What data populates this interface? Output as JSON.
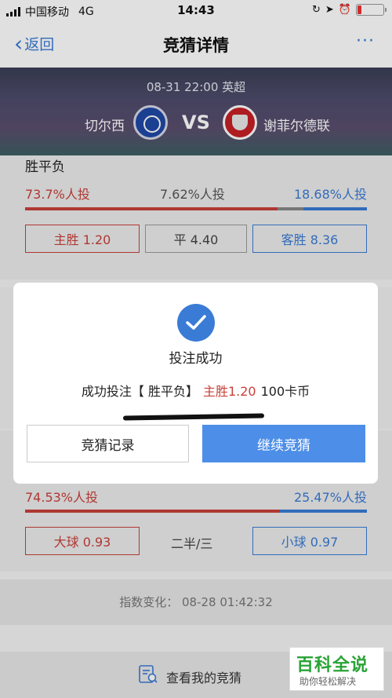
{
  "status_bar": {
    "carrier": "中国移动",
    "network": "4G",
    "time": "14:43"
  },
  "nav": {
    "back_label": "返回",
    "title": "竞猜详情",
    "more_label": "···"
  },
  "match": {
    "datetime_league": "08-31 22:00 英超",
    "home_team": "切尔西",
    "vs": "VS",
    "away_team": "谢菲尔德联"
  },
  "market_1x2": {
    "title": "胜平负",
    "home_pct": "73.7%人投",
    "draw_pct": "7.62%人投",
    "away_pct": "18.68%人投",
    "home_option": "主胜 1.20",
    "draw_option": "平 4.40",
    "away_option": "客胜 8.36"
  },
  "market_total": {
    "over_pct": "74.53%人投",
    "under_pct": "25.47%人投",
    "over_option": "大球 0.93",
    "line": "二半/三",
    "under_option": "小球 0.97"
  },
  "index_change": "指数变化： 08-28 01:42:32",
  "footer": {
    "my_bets_label": "查看我的竞猜"
  },
  "modal": {
    "message": "投注成功",
    "detail_prefix": "成功投注【 胜平负】",
    "detail_selection": "主胜1.20",
    "detail_amount": "100卡币",
    "records_button": "竞猜记录",
    "continue_button": "继续竞猜"
  },
  "watermark": {
    "title": "百科全说",
    "subtitle": "助你轻松解决"
  },
  "colors": {
    "accent_blue": "#3a7bd5",
    "accent_red": "#c8403a",
    "primary_button": "#4d8ee8"
  }
}
